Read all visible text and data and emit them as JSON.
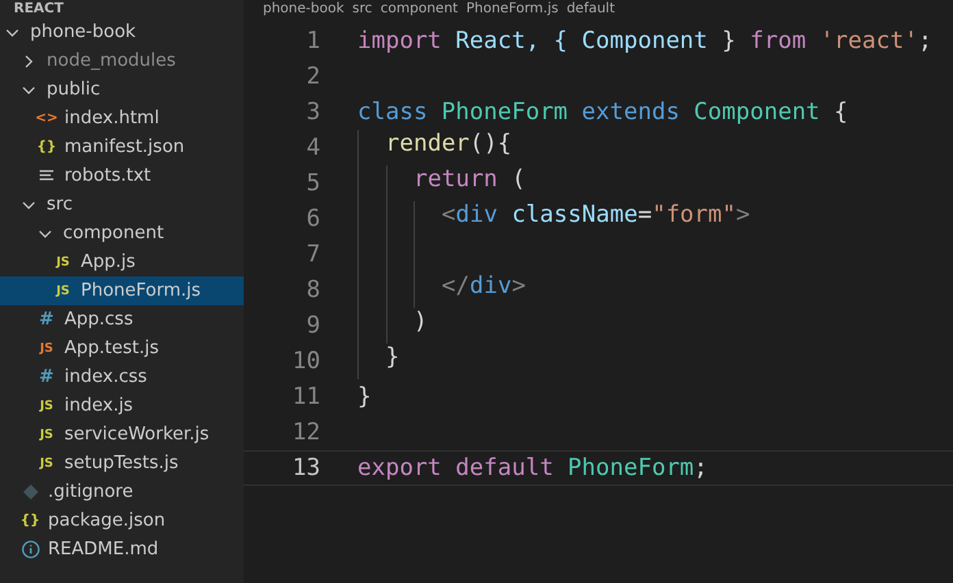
{
  "sidebar": {
    "header": "REACT",
    "tree": [
      {
        "name": "phone-book",
        "kind": "folder",
        "expanded": true,
        "selected": false,
        "children": [
          {
            "name": "node_modules",
            "kind": "folder",
            "expanded": false,
            "dimmed": true,
            "selected": false
          },
          {
            "name": "public",
            "kind": "folder",
            "expanded": true,
            "selected": false,
            "children": [
              {
                "name": "index.html",
                "kind": "html",
                "icon": "<>",
                "selected": false
              },
              {
                "name": "manifest.json",
                "kind": "json",
                "icon": "{}",
                "selected": false
              },
              {
                "name": "robots.txt",
                "kind": "txt",
                "selected": false
              }
            ]
          },
          {
            "name": "src",
            "kind": "folder",
            "expanded": true,
            "selected": false,
            "children": [
              {
                "name": "component",
                "kind": "folder",
                "expanded": true,
                "selected": false,
                "children": [
                  {
                    "name": "App.js",
                    "kind": "js",
                    "icon": "JS",
                    "selected": false
                  },
                  {
                    "name": "PhoneForm.js",
                    "kind": "js",
                    "icon": "JS",
                    "selected": true
                  }
                ]
              },
              {
                "name": "App.css",
                "kind": "css",
                "icon": "#",
                "selected": false
              },
              {
                "name": "App.test.js",
                "kind": "test",
                "icon": "JS",
                "selected": false
              },
              {
                "name": "index.css",
                "kind": "css",
                "icon": "#",
                "selected": false
              },
              {
                "name": "index.js",
                "kind": "js",
                "icon": "JS",
                "selected": false
              },
              {
                "name": "serviceWorker.js",
                "kind": "js",
                "icon": "JS",
                "selected": false
              },
              {
                "name": "setupTests.js",
                "kind": "js",
                "icon": "JS",
                "selected": false
              }
            ]
          },
          {
            "name": ".gitignore",
            "kind": "git",
            "selected": false
          },
          {
            "name": "package.json",
            "kind": "json",
            "icon": "{}",
            "selected": false
          },
          {
            "name": "README.md",
            "kind": "info",
            "selected": false
          }
        ]
      }
    ]
  },
  "breadcrumbs": [
    "phone-book",
    "src",
    "component",
    "PhoneForm.js",
    "default"
  ],
  "editor": {
    "lines": [
      {
        "number": "1",
        "current": false,
        "tokens": [
          {
            "text": "import ",
            "kind": "keyword"
          },
          {
            "text": "React, { ",
            "kind": "variable"
          },
          {
            "text": "Component",
            "kind": "variable"
          },
          {
            "text": " } ",
            "kind": "plain"
          },
          {
            "text": "from ",
            "kind": "keyword"
          },
          {
            "text": "'react'",
            "kind": "string"
          },
          {
            "text": ";",
            "kind": "plain"
          }
        ]
      },
      {
        "number": "2",
        "current": false
      },
      {
        "number": "3",
        "current": false,
        "tokens": [
          {
            "text": "class ",
            "kind": "storage"
          },
          {
            "text": "PhoneForm ",
            "kind": "type"
          },
          {
            "text": "extends ",
            "kind": "storage"
          },
          {
            "text": "Component",
            "kind": "type"
          },
          {
            "text": " {",
            "kind": "plain"
          }
        ],
        "children": [
          {
            "number": "4",
            "current": false,
            "tokens": [
              {
                "text": "render",
                "kind": "function"
              },
              {
                "text": "(){",
                "kind": "plain"
              }
            ],
            "children": [
              {
                "number": "5",
                "current": false,
                "tokens": [
                  {
                    "text": "return",
                    "kind": "keyword"
                  },
                  {
                    "text": " (",
                    "kind": "plain"
                  }
                ],
                "children": [
                  {
                    "number": "6",
                    "current": false,
                    "tokens": [
                      {
                        "text": "<",
                        "kind": "punct"
                      },
                      {
                        "text": "div ",
                        "kind": "storage"
                      },
                      {
                        "text": "className",
                        "kind": "variable"
                      },
                      {
                        "text": "=",
                        "kind": "plain"
                      },
                      {
                        "text": "\"form\"",
                        "kind": "string"
                      },
                      {
                        "text": ">",
                        "kind": "punct"
                      }
                    ]
                  },
                  {
                    "number": "7",
                    "current": false
                  },
                  {
                    "number": "8",
                    "current": false,
                    "tokens": [
                      {
                        "text": "</",
                        "kind": "punct"
                      },
                      {
                        "text": "div",
                        "kind": "storage"
                      },
                      {
                        "text": ">",
                        "kind": "punct"
                      }
                    ]
                  }
                ]
              },
              {
                "number": "9",
                "current": false,
                "tokens": [
                  {
                    "text": ")",
                    "kind": "plain"
                  }
                ]
              }
            ]
          },
          {
            "number": "10",
            "current": false,
            "tokens": [
              {
                "text": "}",
                "kind": "plain"
              }
            ]
          }
        ]
      },
      {
        "number": "11",
        "current": false,
        "tokens": [
          {
            "text": "}",
            "kind": "plain"
          }
        ]
      },
      {
        "number": "12",
        "current": false
      },
      {
        "number": "13",
        "current": true,
        "tokens": [
          {
            "text": "export ",
            "kind": "keyword"
          },
          {
            "text": "default ",
            "kind": "keyword"
          },
          {
            "text": "PhoneForm",
            "kind": "type"
          },
          {
            "text": ";",
            "kind": "plain"
          }
        ]
      }
    ]
  }
}
